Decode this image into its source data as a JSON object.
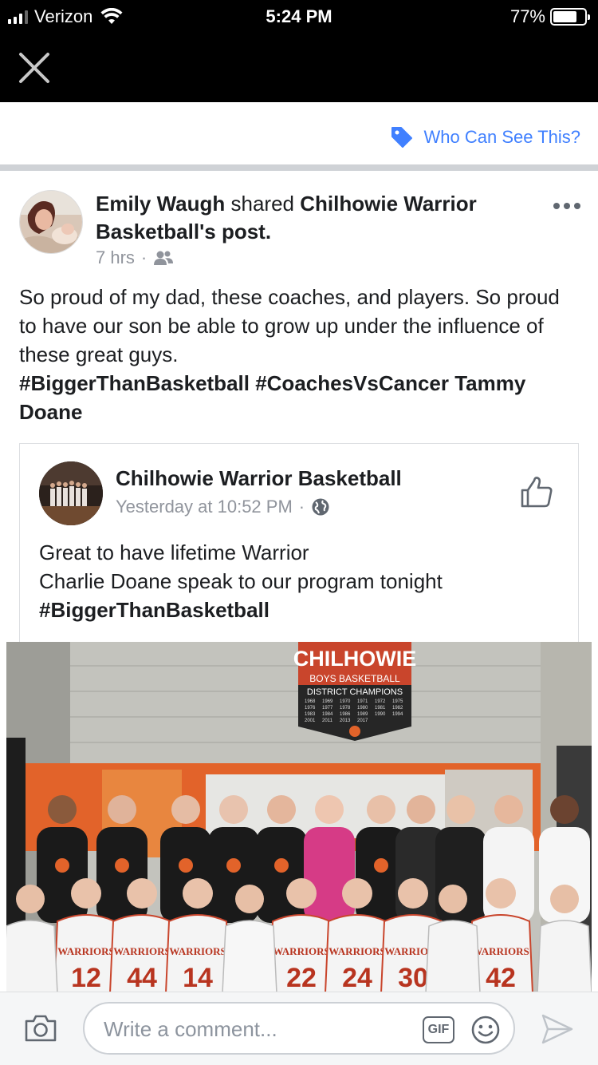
{
  "status_bar": {
    "carrier": "Verizon",
    "time": "5:24 PM",
    "battery_percent": "77%",
    "battery_level": 0.77,
    "signal_bars": 3
  },
  "privacy": {
    "label": "Who Can See This?",
    "icon": "tag-icon",
    "color": "#4080ff"
  },
  "post": {
    "author": "Emily Waugh",
    "action": "shared",
    "source_page": "Chilhowie Warrior Basketball",
    "source_suffix": "'s post.",
    "time": "7 hrs",
    "audience_icon": "friends-icon",
    "text_lines": [
      "So proud of my dad, these coaches, and players. So proud to have our son be able to grow up under the influence of these great guys."
    ],
    "tags_line": "#BiggerThanBasketball #CoachesVsCancer Tammy Doane"
  },
  "shared_post": {
    "page_name": "Chilhowie Warrior Basketball",
    "time": "Yesterday at 10:52 PM",
    "audience_icon": "globe-icon",
    "line1": "Great to have lifetime Warrior",
    "line2": "Charlie Doane speak to our program tonight",
    "tags": "#BiggerThanBasketball"
  },
  "photo": {
    "banner_title": "CHILHOWIE",
    "banner_subtitle": "BOYS BASKETBALL",
    "banner_heading": "DISTRICT CHAMPIONS",
    "banner_years": [
      "1968",
      "1969",
      "1970",
      "1971",
      "1972",
      "1975",
      "1976",
      "1977",
      "1978",
      "1980",
      "1981",
      "1982",
      "1983",
      "1984",
      "1986",
      "1989",
      "1990",
      "1994",
      "2001",
      "2011",
      "2013",
      "2017"
    ],
    "jersey_numbers": [
      "12",
      "44",
      "14",
      "22",
      "24",
      "30",
      "42"
    ],
    "jersey_text": "WARRIORS"
  },
  "comment_bar": {
    "placeholder": "Write a comment...",
    "gif_label": "GIF"
  }
}
